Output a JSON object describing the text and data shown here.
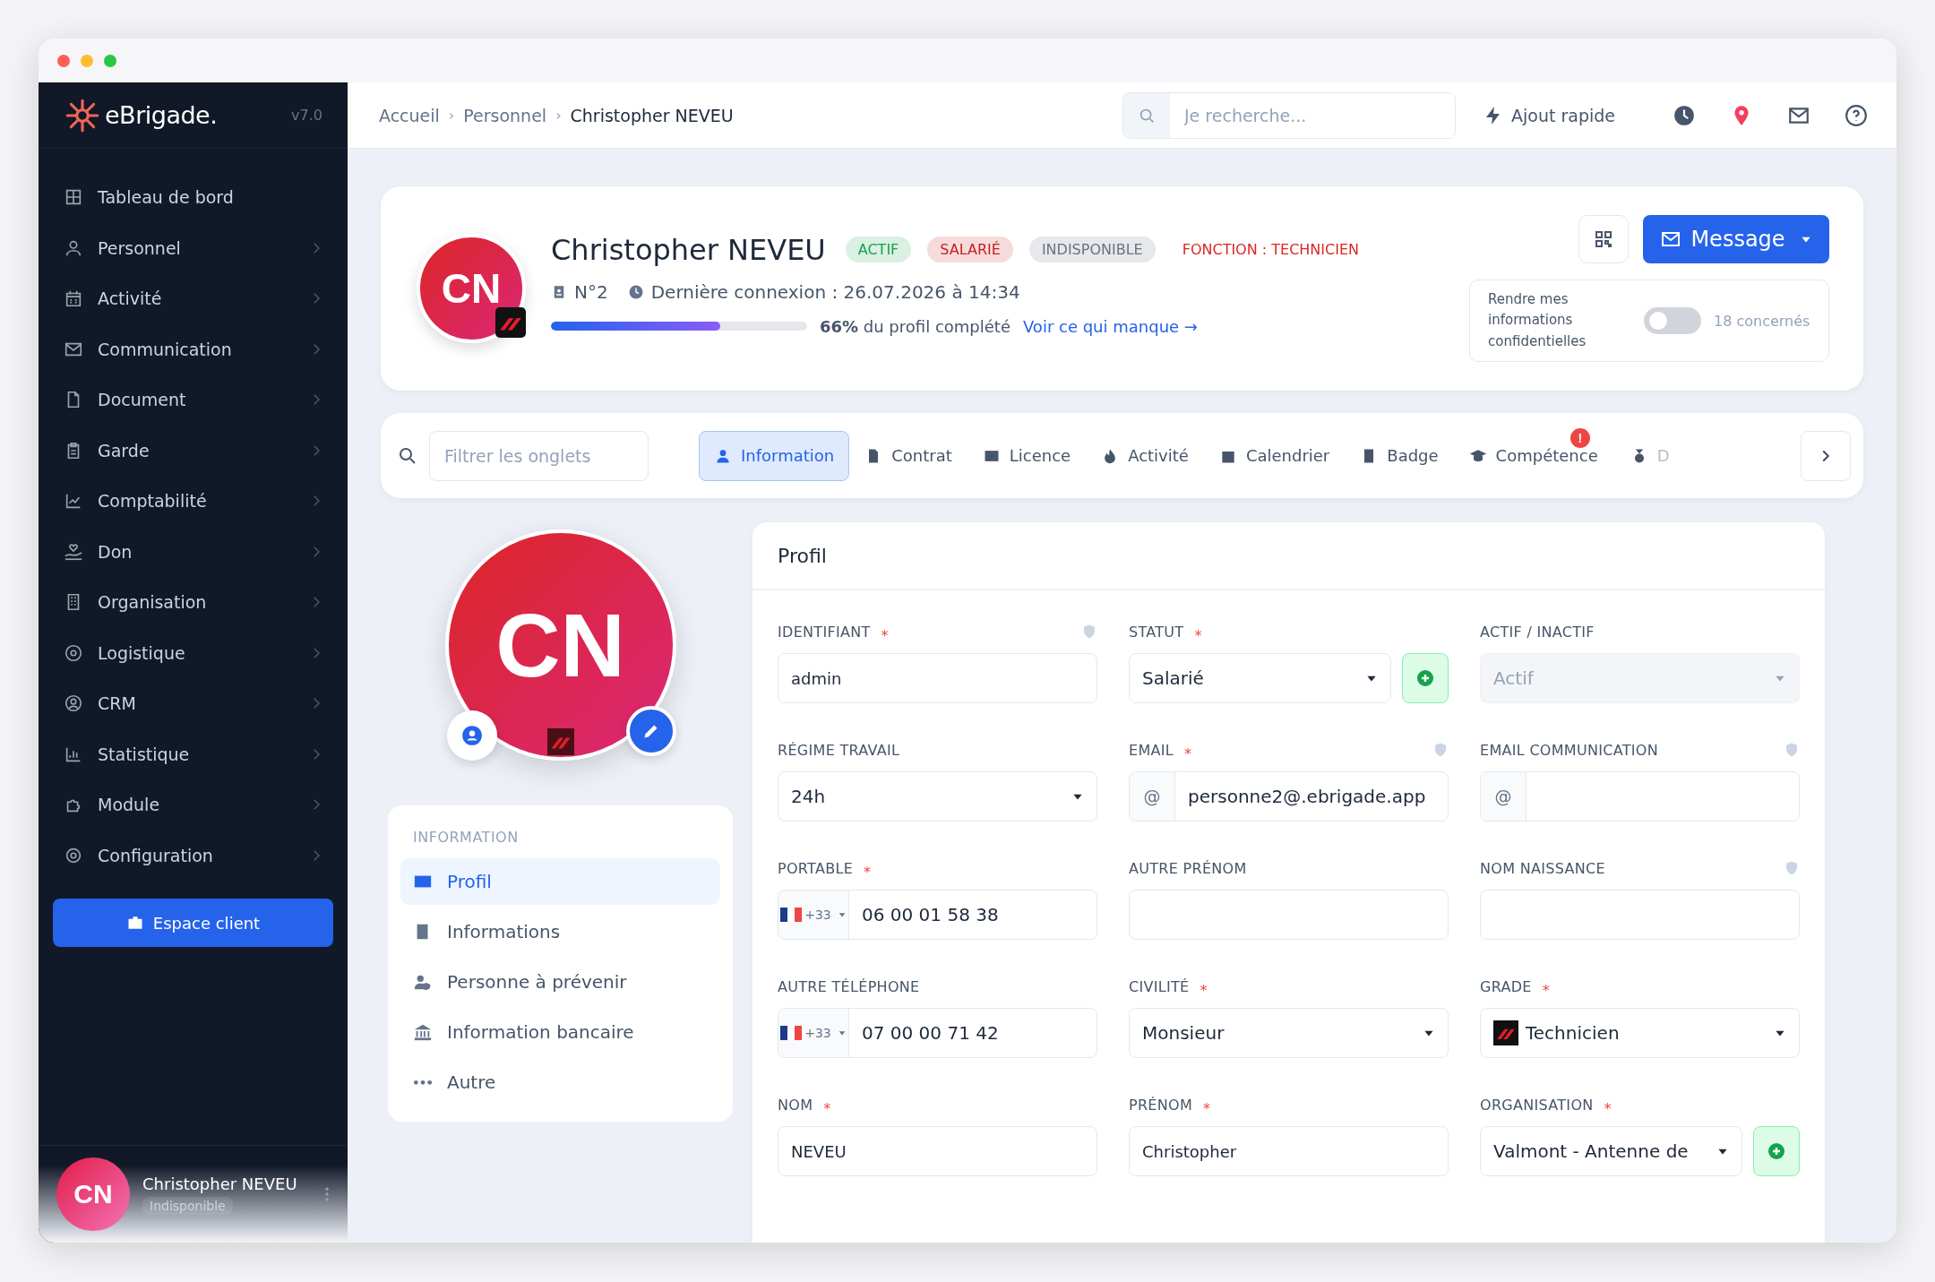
{
  "sidebar": {
    "brand": "eBrigade.",
    "version": "v7.0",
    "items": [
      {
        "label": "Tableau de bord",
        "submenu": false
      },
      {
        "label": "Personnel",
        "submenu": true
      },
      {
        "label": "Activité",
        "submenu": true
      },
      {
        "label": "Communication",
        "submenu": true
      },
      {
        "label": "Document",
        "submenu": true
      },
      {
        "label": "Garde",
        "submenu": true
      },
      {
        "label": "Comptabilité",
        "submenu": true
      },
      {
        "label": "Don",
        "submenu": true
      },
      {
        "label": "Organisation",
        "submenu": true
      },
      {
        "label": "Logistique",
        "submenu": true
      },
      {
        "label": "CRM",
        "submenu": true
      },
      {
        "label": "Statistique",
        "submenu": true
      },
      {
        "label": "Module",
        "submenu": true
      },
      {
        "label": "Configuration",
        "submenu": true
      }
    ],
    "client_button": "Espace client",
    "user": {
      "initials": "CN",
      "name": "Christopher NEVEU",
      "status": "Indisponible"
    }
  },
  "topbar": {
    "breadcrumb": [
      "Accueil",
      "Personnel",
      "Christopher NEVEU"
    ],
    "separators": [
      "›",
      "›"
    ],
    "search": {
      "placeholder": "Je recherche..."
    },
    "quick_add": "Ajout rapide"
  },
  "profile_header": {
    "initials": "CN",
    "name": "Christopher NEVEU",
    "badges": [
      {
        "label": "ACTIF",
        "color": "#16a34a"
      },
      {
        "label": "SALARIÉ",
        "color": "#c81e1e"
      },
      {
        "label": "INDISPONIBLE",
        "color": "#6b7280"
      }
    ],
    "function": "FONCTION : TECHNICIEN",
    "number": "N°2",
    "last_login": "Dernière connexion : 26.07.2026 à 14:34",
    "level": 0.66,
    "completion": "**66%** du profil complété",
    "missing_link": "Voir ce qui manque →",
    "message_button": "Message",
    "confidential": {
      "label": "Rendre mes informations confidentielles",
      "on": false,
      "count": "18 concernés"
    }
  },
  "tabs": {
    "filter_placeholder": "Filtrer les onglets",
    "items": [
      {
        "label": "Information",
        "selected": true
      },
      {
        "label": "Contrat",
        "selected": false
      },
      {
        "label": "Licence",
        "selected": false
      },
      {
        "label": "Activité",
        "selected": false
      },
      {
        "label": "Calendrier",
        "selected": false
      },
      {
        "label": "Badge",
        "selected": false
      },
      {
        "label": "Compétence",
        "selected": false,
        "alert": "!"
      },
      {
        "label": "D",
        "selected": false
      }
    ]
  },
  "side_nav": {
    "initials": "CN",
    "heading": "INFORMATION",
    "items": [
      {
        "label": "Profil",
        "selected": true
      },
      {
        "label": "Informations",
        "selected": false
      },
      {
        "label": "Personne à prévenir",
        "selected": false
      },
      {
        "label": "Information bancaire",
        "selected": false
      },
      {
        "label": "Autre",
        "selected": false
      }
    ]
  },
  "profile_form": {
    "title": "Profil",
    "fields": [
      {
        "label": "IDENTIFIANT",
        "kind": "text",
        "required_mark": "*",
        "private": true,
        "disabled": false,
        "add_button": false,
        "value": "admin"
      },
      {
        "label": "STATUT",
        "kind": "select",
        "required_mark": "*",
        "private": false,
        "disabled": false,
        "add_button": true,
        "value": "Salarié"
      },
      {
        "label": "ACTIF / INACTIF",
        "kind": "select",
        "private": false,
        "disabled": true,
        "add_button": false,
        "value": "Actif"
      },
      {
        "label": "RÉGIME TRAVAIL",
        "kind": "select",
        "private": false,
        "disabled": false,
        "add_button": false,
        "value": "24h"
      },
      {
        "label": "EMAIL",
        "kind": "email",
        "required_mark": "*",
        "private": true,
        "disabled": false,
        "add_button": false,
        "prefix": "@",
        "value": "personne2@.ebrigade.app"
      },
      {
        "label": "EMAIL COMMUNICATION",
        "kind": "email",
        "private": true,
        "disabled": false,
        "add_button": false,
        "prefix": "@"
      },
      {
        "label": "PORTABLE",
        "kind": "phone",
        "required_mark": "*",
        "private": false,
        "disabled": false,
        "add_button": false,
        "dial_code": "+33",
        "value": "06 00 01 58 38"
      },
      {
        "label": "AUTRE PRÉNOM",
        "kind": "text",
        "private": false,
        "disabled": false,
        "add_button": false
      },
      {
        "label": "NOM NAISSANCE",
        "kind": "text",
        "private": true,
        "disabled": false,
        "add_button": false
      },
      {
        "label": "AUTRE TÉLÉPHONE",
        "kind": "phone",
        "private": false,
        "disabled": false,
        "add_button": false,
        "dial_code": "+33",
        "value": "07 00 00 71 42"
      },
      {
        "label": "CIVILITÉ",
        "kind": "select",
        "required_mark": "*",
        "private": false,
        "disabled": false,
        "add_button": false,
        "value": "Monsieur"
      },
      {
        "label": "GRADE",
        "kind": "grade",
        "required_mark": "*",
        "private": false,
        "disabled": false,
        "add_button": false,
        "value": "Technicien"
      },
      {
        "label": "NOM",
        "kind": "text",
        "required_mark": "*",
        "private": false,
        "disabled": false,
        "add_button": false,
        "value": "NEVEU"
      },
      {
        "label": "PRÉNOM",
        "kind": "text",
        "required_mark": "*",
        "private": false,
        "disabled": false,
        "add_button": false,
        "value": "Christopher"
      },
      {
        "label": "ORGANISATION",
        "kind": "select",
        "required_mark": "*",
        "private": false,
        "disabled": false,
        "add_button": true,
        "value": "Valmont - Antenne de"
      }
    ]
  }
}
